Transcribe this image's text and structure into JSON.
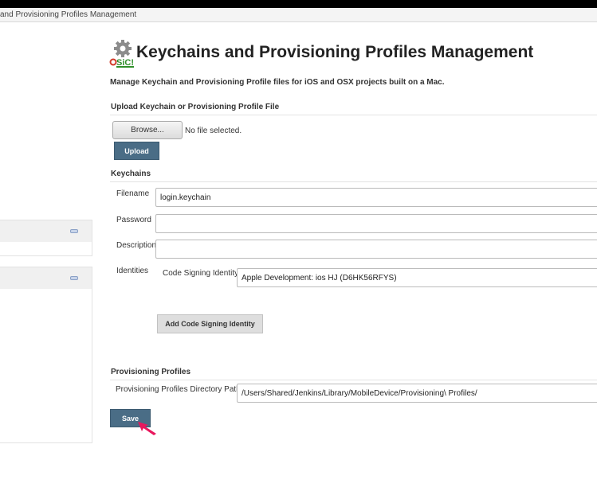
{
  "breadcrumb": {
    "text": "and Provisioning Profiles Management"
  },
  "header": {
    "title": "Keychains and Provisioning Profiles Management",
    "description": "Manage Keychain and Provisioning Profile files for iOS and OSX projects built on a Mac.",
    "logo_text": "SiC!"
  },
  "upload": {
    "section_title": "Upload Keychain or Provisioning Profile File",
    "browse_label": "Browse...",
    "file_status": "No file selected.",
    "upload_label": "Upload"
  },
  "keychains": {
    "section_title": "Keychains",
    "filename_label": "Filename",
    "filename_value": "login.keychain",
    "password_label": "Password",
    "password_value": "",
    "description_label": "Description",
    "description_value": "",
    "identities_label": "Identities",
    "code_signing_label": "Code Signing Identity",
    "code_signing_value": "Apple Development: ios HJ (D6HK56RFYS)",
    "add_identity_label": "Add Code Signing Identity"
  },
  "provisioning": {
    "section_title": "Provisioning Profiles",
    "dir_label": "Provisioning Profiles Directory Path",
    "dir_value": "/Users/Shared/Jenkins/Library/MobileDevice/Provisioning\\ Profiles/"
  },
  "actions": {
    "save_label": "Save"
  },
  "colors": {
    "primary_button": "#4a6d86",
    "cursor": "#e8175d"
  }
}
